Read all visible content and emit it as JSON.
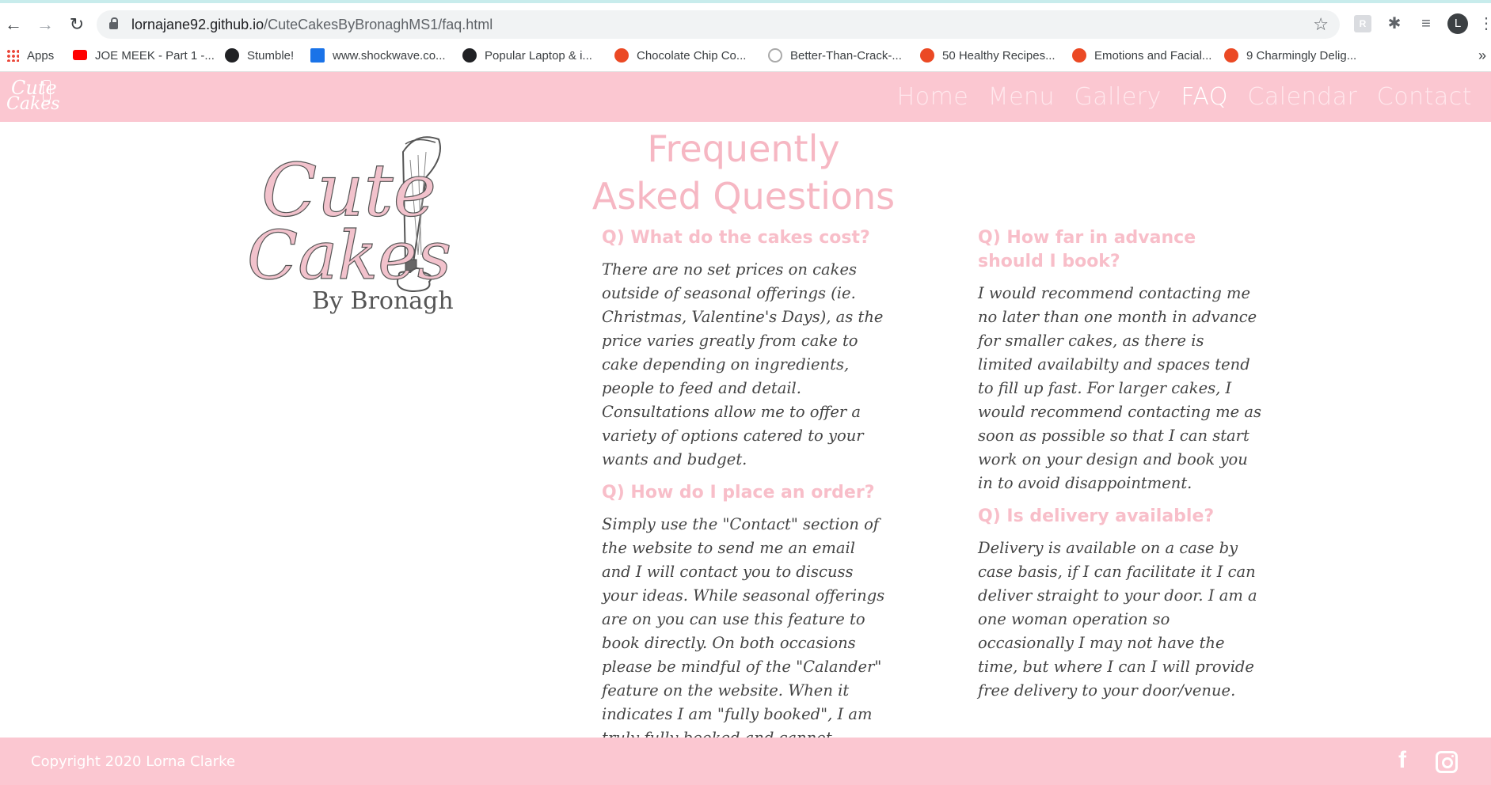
{
  "browser": {
    "url_host": "lornajane92.github.io",
    "url_path": "/CuteCakesByBronaghMS1/faq.html",
    "profile_initial": "L",
    "bookmarks": [
      "Apps",
      "JOE MEEK - Part 1 -...",
      "Stumble!",
      "www.shockwave.co...",
      "Popular Laptop & i...",
      "Chocolate Chip Co...",
      "Better-Than-Crack-...",
      "50 Healthy Recipes...",
      "Emotions and Facial...",
      "9 Charmingly Delig..."
    ]
  },
  "site": {
    "logo_line1": "Cute",
    "logo_line2": "Cakes",
    "brand_line1": "Cute",
    "brand_line2": "Cakes",
    "brand_line3": "By Bronagh",
    "nav": [
      "Home",
      "Menu",
      "Gallery",
      "FAQ",
      "Calendar",
      "Contact"
    ],
    "active_nav": "FAQ"
  },
  "page": {
    "title": "Frequently Asked Questions",
    "faq": [
      {
        "q": "Q) What do the cakes cost?",
        "a": "There are no set prices on cakes outside of seasonal offerings (ie. Christmas, Valentine's Days), as the price varies greatly from cake to cake depending on ingredients, people to feed and detail. Consultations allow me to offer a variety of options catered to your wants and budget."
      },
      {
        "q": "Q) How do I place an order?",
        "a": "Simply use the \"Contact\" section of the website to send me an email and I will contact you to discuss your ideas. While seasonal offerings are on you can use this feature to book directly. On both occasions please be mindful of the \"Calander\" feature on the website. When it indicates I am \"fully booked\", I am truly fully booked and cannot facilitate an order at this time."
      },
      {
        "q": "Q) How far in advance should I book?",
        "a": "I would recommend contacting me no later than one month in advance for smaller cakes, as there is limited availabilty and spaces tend to fill up fast. For larger cakes, I would recommend contacting me as soon as possible so that I can start work on your design and book you in to avoid disappointment."
      },
      {
        "q": "Q) Is delivery available?",
        "a": "Delivery is available on a case by case basis, if I can facilitate it I can deliver straight to your door. I am a one woman operation so occasionally I may not have the time, but where I can I will provide free delivery to your door/venue."
      }
    ]
  },
  "footer": {
    "copyright": "Copyright 2020 Lorna Clarke",
    "social_icons": [
      "facebook-icon",
      "instagram-icon"
    ]
  },
  "colors": {
    "brand_pink": "#fbc7d1",
    "heading_pink": "#f6b7c3",
    "body_text": "#444444"
  }
}
